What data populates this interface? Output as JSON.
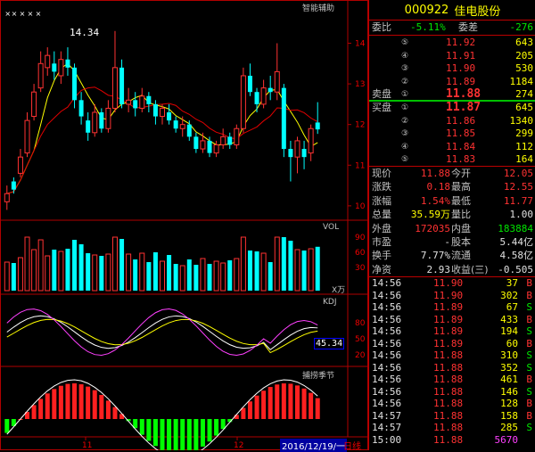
{
  "stock": {
    "code": "000922",
    "name": "佳电股份"
  },
  "indicator_titles": {
    "main": "智能辅助",
    "vol": "VOL",
    "kdj": "KDJ",
    "wave": "捕捞季节"
  },
  "price_label": "14.34",
  "vol_unit": "X万",
  "kdj_value": "45.34",
  "date_label": "2016/12/19/一",
  "period_label": "日线",
  "x_ticks": [
    "11",
    "12"
  ],
  "y_ticks_price": [
    "14",
    "13",
    "12",
    "11",
    "10"
  ],
  "y_ticks_vol": [
    "90",
    "60",
    "30"
  ],
  "y_ticks_kdj": [
    "80",
    "50",
    "20"
  ],
  "header": {
    "wb_label": "委比",
    "wb_value": "-5.11%",
    "wc_label": "委差",
    "wc_value": "-276"
  },
  "sell": [
    {
      "n": "⑤",
      "p": "11.92",
      "v": "643"
    },
    {
      "n": "④",
      "p": "11.91",
      "v": "205"
    },
    {
      "n": "③",
      "p": "11.90",
      "v": "530"
    },
    {
      "n": "②",
      "p": "11.89",
      "v": "1184"
    },
    {
      "n": "①",
      "p": "11.88",
      "v": "274",
      "label": "卖盘"
    }
  ],
  "buy": [
    {
      "n": "①",
      "p": "11.87",
      "v": "645",
      "label": "买盘"
    },
    {
      "n": "②",
      "p": "11.86",
      "v": "1340"
    },
    {
      "n": "③",
      "p": "11.85",
      "v": "299"
    },
    {
      "n": "④",
      "p": "11.84",
      "v": "112"
    },
    {
      "n": "⑤",
      "p": "11.83",
      "v": "164"
    }
  ],
  "stats": [
    {
      "l1": "现价",
      "v1": "11.88",
      "l2": "今开",
      "v2": "12.05"
    },
    {
      "l1": "涨跌",
      "v1": "0.18",
      "l2": "最高",
      "v2": "12.55"
    },
    {
      "l1": "涨幅",
      "v1": "1.54%",
      "l2": "最低",
      "v2": "11.77"
    },
    {
      "l1": "总量",
      "v1": "35.59万",
      "l2": "量比",
      "v2": "1.00"
    },
    {
      "l1": "外盘",
      "v1": "172035",
      "l2": "内盘",
      "v2": "183884"
    },
    {
      "l1": "市盈",
      "v1": "-",
      "l2": "股本",
      "v2": "5.44亿"
    },
    {
      "l1": "换手",
      "v1": "7.77%",
      "l2": "流通",
      "v2": "4.58亿"
    },
    {
      "l1": "净资",
      "v1": "2.93",
      "l2": "收益(三)",
      "v2": "-0.505"
    }
  ],
  "ticks": [
    {
      "t": "14:56",
      "p": "11.90",
      "v": "37",
      "d": "B"
    },
    {
      "t": "14:56",
      "p": "11.90",
      "v": "302",
      "d": "B"
    },
    {
      "t": "14:56",
      "p": "11.89",
      "v": "67",
      "d": "S"
    },
    {
      "t": "14:56",
      "p": "11.89",
      "v": "433",
      "d": "B"
    },
    {
      "t": "14:56",
      "p": "11.89",
      "v": "194",
      "d": "S"
    },
    {
      "t": "14:56",
      "p": "11.89",
      "v": "60",
      "d": "B"
    },
    {
      "t": "14:56",
      "p": "11.88",
      "v": "310",
      "d": "S"
    },
    {
      "t": "14:56",
      "p": "11.88",
      "v": "352",
      "d": "S"
    },
    {
      "t": "14:56",
      "p": "11.88",
      "v": "461",
      "d": "B"
    },
    {
      "t": "14:56",
      "p": "11.88",
      "v": "146",
      "d": "S"
    },
    {
      "t": "14:56",
      "p": "11.88",
      "v": "128",
      "d": "B"
    },
    {
      "t": "14:57",
      "p": "11.88",
      "v": "158",
      "d": "B"
    },
    {
      "t": "14:57",
      "p": "11.88",
      "v": "285",
      "d": "S"
    },
    {
      "t": "15:00",
      "p": "11.88",
      "v": "5670",
      "d": ""
    }
  ],
  "chart_data": {
    "type": "candlestick",
    "ylim": [
      9.8,
      14.8
    ],
    "candles": [
      {
        "o": 10.1,
        "c": 10.3,
        "h": 10.5,
        "l": 9.9
      },
      {
        "o": 10.6,
        "c": 10.4,
        "h": 10.7,
        "l": 10.3
      },
      {
        "o": 10.8,
        "c": 11.2,
        "h": 11.4,
        "l": 10.7
      },
      {
        "o": 11.3,
        "c": 12.1,
        "h": 12.3,
        "l": 11.2
      },
      {
        "o": 12.2,
        "c": 12.8,
        "h": 13.0,
        "l": 12.1
      },
      {
        "o": 12.9,
        "c": 13.5,
        "h": 13.8,
        "l": 12.8
      },
      {
        "o": 13.4,
        "c": 13.7,
        "h": 13.9,
        "l": 13.2
      },
      {
        "o": 13.5,
        "c": 13.3,
        "h": 13.8,
        "l": 13.1
      },
      {
        "o": 13.2,
        "c": 13.6,
        "h": 13.8,
        "l": 13.0
      },
      {
        "o": 13.6,
        "c": 13.4,
        "h": 13.9,
        "l": 13.2
      },
      {
        "o": 13.4,
        "c": 12.6,
        "h": 13.5,
        "l": 12.4
      },
      {
        "o": 12.6,
        "c": 12.2,
        "h": 12.8,
        "l": 12.0
      },
      {
        "o": 12.1,
        "c": 11.8,
        "h": 12.3,
        "l": 11.6
      },
      {
        "o": 11.8,
        "c": 12.3,
        "h": 12.5,
        "l": 11.7
      },
      {
        "o": 12.3,
        "c": 11.9,
        "h": 12.4,
        "l": 11.8
      },
      {
        "o": 11.9,
        "c": 12.4,
        "h": 12.6,
        "l": 11.8
      },
      {
        "o": 12.4,
        "c": 13.4,
        "h": 14.3,
        "l": 12.3
      },
      {
        "o": 13.4,
        "c": 12.5,
        "h": 13.6,
        "l": 12.4
      },
      {
        "o": 12.5,
        "c": 12.6,
        "h": 12.9,
        "l": 12.3
      },
      {
        "o": 12.6,
        "c": 12.4,
        "h": 12.8,
        "l": 12.2
      },
      {
        "o": 12.4,
        "c": 12.7,
        "h": 12.9,
        "l": 12.3
      },
      {
        "o": 12.7,
        "c": 12.5,
        "h": 12.8,
        "l": 12.3
      },
      {
        "o": 12.5,
        "c": 12.2,
        "h": 12.6,
        "l": 12.0
      },
      {
        "o": 12.2,
        "c": 12.4,
        "h": 12.5,
        "l": 12.0
      },
      {
        "o": 12.3,
        "c": 12.1,
        "h": 12.5,
        "l": 12.0
      },
      {
        "o": 12.1,
        "c": 11.9,
        "h": 12.2,
        "l": 11.8
      },
      {
        "o": 11.9,
        "c": 12.0,
        "h": 12.2,
        "l": 11.7
      },
      {
        "o": 12.0,
        "c": 11.7,
        "h": 12.1,
        "l": 11.6
      },
      {
        "o": 11.7,
        "c": 11.4,
        "h": 11.8,
        "l": 11.3
      },
      {
        "o": 11.4,
        "c": 11.6,
        "h": 11.8,
        "l": 11.3
      },
      {
        "o": 11.6,
        "c": 11.3,
        "h": 11.7,
        "l": 11.2
      },
      {
        "o": 11.3,
        "c": 11.5,
        "h": 11.6,
        "l": 11.2
      },
      {
        "o": 11.5,
        "c": 11.7,
        "h": 11.9,
        "l": 11.4
      },
      {
        "o": 11.7,
        "c": 11.5,
        "h": 11.8,
        "l": 11.4
      },
      {
        "o": 11.5,
        "c": 11.9,
        "h": 12.0,
        "l": 11.4
      },
      {
        "o": 11.9,
        "c": 13.2,
        "h": 13.4,
        "l": 11.8
      },
      {
        "o": 13.2,
        "c": 12.8,
        "h": 13.5,
        "l": 12.7
      },
      {
        "o": 12.8,
        "c": 12.5,
        "h": 12.9,
        "l": 12.3
      },
      {
        "o": 12.5,
        "c": 12.9,
        "h": 13.1,
        "l": 12.4
      },
      {
        "o": 12.9,
        "c": 12.8,
        "h": 13.2,
        "l": 12.6
      },
      {
        "o": 12.8,
        "c": 13.3,
        "h": 14.0,
        "l": 12.6
      },
      {
        "o": 12.9,
        "c": 11.4,
        "h": 13.0,
        "l": 11.2
      },
      {
        "o": 11.4,
        "c": 11.2,
        "h": 11.6,
        "l": 10.6
      },
      {
        "o": 11.2,
        "c": 11.6,
        "h": 11.7,
        "l": 10.8
      },
      {
        "o": 11.4,
        "c": 11.2,
        "h": 11.6,
        "l": 10.9
      },
      {
        "o": 11.3,
        "c": 11.9,
        "h": 12.0,
        "l": 11.1
      },
      {
        "o": 12.05,
        "c": 11.88,
        "h": 12.55,
        "l": 11.77
      }
    ]
  }
}
